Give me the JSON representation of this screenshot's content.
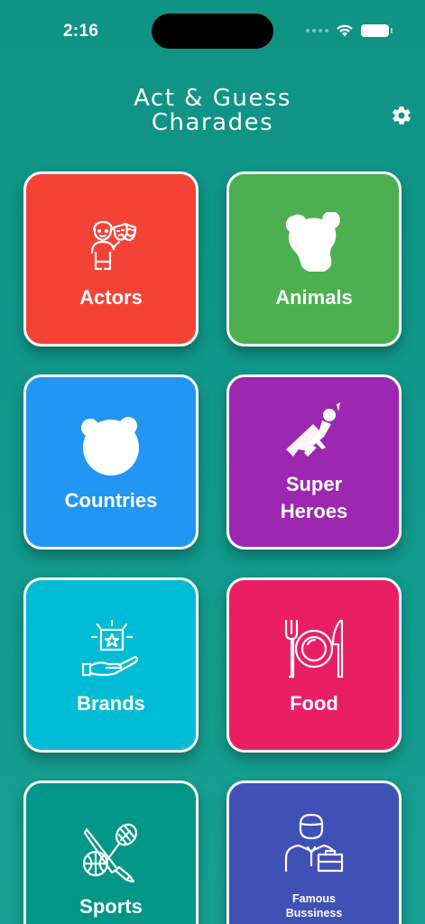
{
  "status": {
    "time": "2:16"
  },
  "header": {
    "title_line1": "Act & Guess",
    "title_line2": "Charades",
    "settings_icon": "gear-icon"
  },
  "categories": [
    {
      "label": "Actors",
      "color": "#f44336",
      "icon": "theater-masks-icon"
    },
    {
      "label": "Animals",
      "color": "#4caf50",
      "icon": "bear-head-icon"
    },
    {
      "label": "Countries",
      "color": "#2196f3",
      "icon": "bear-face-icon"
    },
    {
      "label_line1": "Super",
      "label_line2": "Heroes",
      "color": "#9c27b0",
      "icon": "superhero-icon"
    },
    {
      "label": "Brands",
      "color": "#00bcd4",
      "icon": "star-box-hand-icon"
    },
    {
      "label": "Food",
      "color": "#e91e63",
      "icon": "plate-fork-knife-icon"
    },
    {
      "label": "Sports",
      "color": "#009688",
      "icon": "sports-equipment-icon"
    },
    {
      "label_line1": "Famous",
      "label_line2": "Bussiness",
      "color": "#3f51b5",
      "icon": "businessman-icon"
    }
  ]
}
